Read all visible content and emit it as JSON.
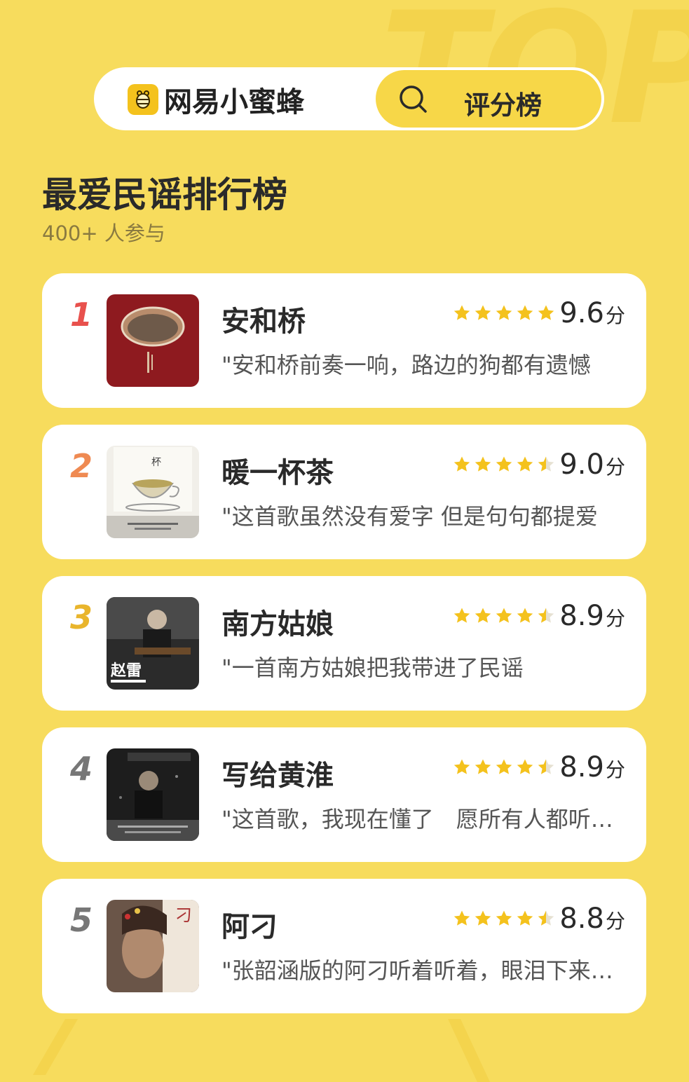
{
  "background": {
    "watermark": "TOP",
    "color": "#f7dc5d"
  },
  "header": {
    "brand_name": "网易小蜜蜂",
    "brand_icon": "bee-icon",
    "search_icon": "search-icon",
    "search_label": "评分榜"
  },
  "page": {
    "title": "最爱民谣排行榜",
    "participants": "400+ 人参与"
  },
  "colors": {
    "rank1": "#e8514d",
    "rank2": "#ef8a52",
    "rank3": "#e9b52c",
    "rank_other": "#777777",
    "star": "#f4c21d"
  },
  "songs": [
    {
      "rank": "1",
      "title": "安和桥",
      "stars": 5,
      "score": "9.6",
      "unit": "分",
      "comment": "\"安和桥前奏一响，路边的狗都有遗憾",
      "cover": "red-album-cover"
    },
    {
      "rank": "2",
      "title": "暖一杯茶",
      "stars": 4.5,
      "score": "9.0",
      "unit": "分",
      "comment": "\"这首歌虽然没有爱字 但是句句都提爱",
      "cover": "tea-cup-cover"
    },
    {
      "rank": "3",
      "title": "南方姑娘",
      "stars": 4.5,
      "score": "8.9",
      "unit": "分",
      "comment": "\"一首南方姑娘把我带进了民谣",
      "cover": "singer-guitar-cover"
    },
    {
      "rank": "4",
      "title": "写给黄淮",
      "stars": 4.5,
      "score": "8.9",
      "unit": "分",
      "comment": "\"这首歌，我现在懂了　愿所有人都听…",
      "cover": "dark-singer-cover"
    },
    {
      "rank": "5",
      "title": "阿刁",
      "stars": 4.5,
      "score": "8.8",
      "unit": "分",
      "comment": "\"张韶涵版的阿刁听着听着，眼泪下来…",
      "cover": "portrait-cover"
    }
  ]
}
